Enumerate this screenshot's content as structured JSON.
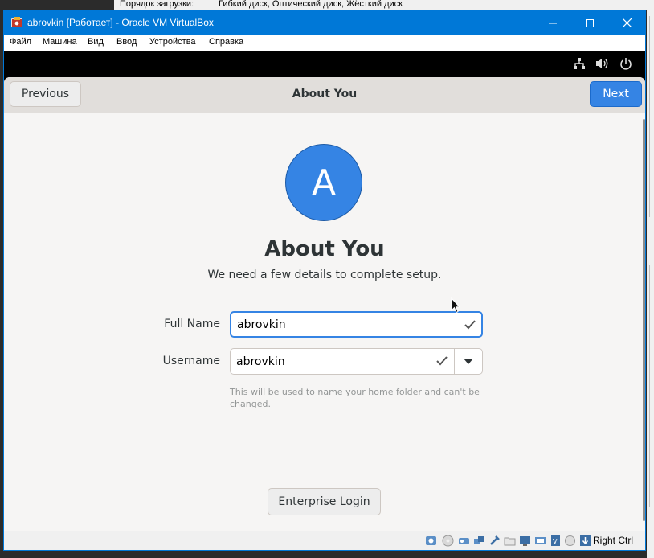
{
  "background_window": {
    "boot_order_label": "Порядок загрузки:",
    "boot_order_value": "Гибкий диск, Оптический диск, Жёсткий диск"
  },
  "window": {
    "title": "abrovkin [Работает] - Oracle VM VirtualBox",
    "accent": "#0078d7"
  },
  "menu": {
    "items": [
      "Файл",
      "Машина",
      "Вид",
      "Ввод",
      "Устройства",
      "Справка"
    ]
  },
  "header": {
    "previous_label": "Previous",
    "title": "About You",
    "next_label": "Next"
  },
  "content": {
    "avatar_letter": "A",
    "title": "About You",
    "subtitle": "We need a few details to complete setup.",
    "full_name_label": "Full Name",
    "full_name_value": "abrovkin",
    "username_label": "Username",
    "username_value": "abrovkin",
    "username_hint": "This will be used to name your home folder and can't be changed.",
    "enterprise_login_label": "Enterprise Login"
  },
  "status": {
    "host_key": "Right Ctrl"
  },
  "colors": {
    "gnome_blue": "#3584e4",
    "window_bg": "#f6f5f4"
  }
}
